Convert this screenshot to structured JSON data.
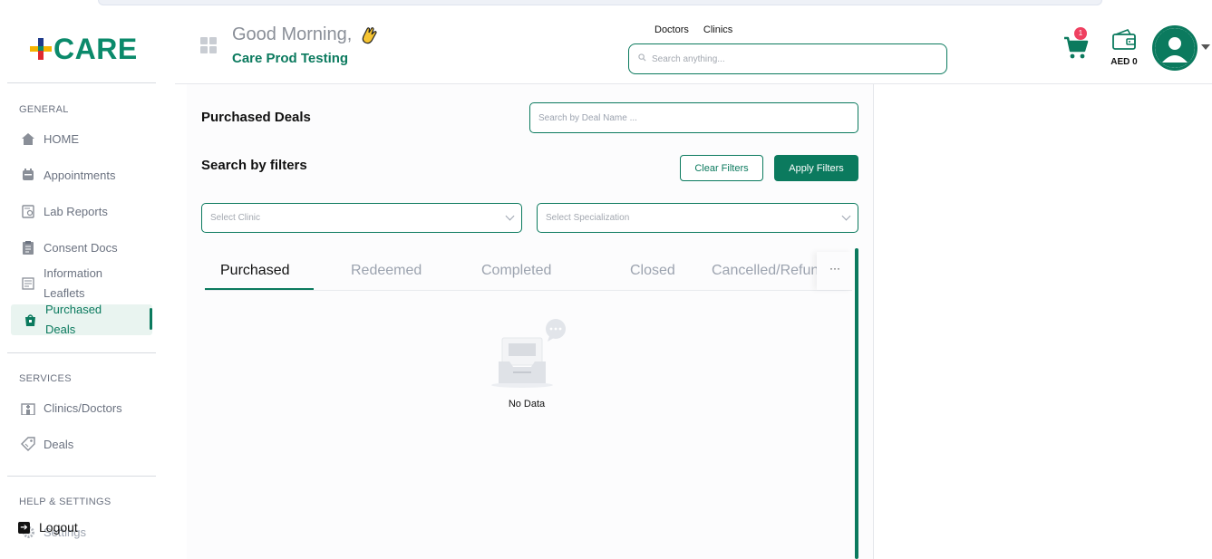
{
  "brand": {
    "name": "CARE"
  },
  "sidebar": {
    "sections": {
      "general": "GENERAL",
      "services": "SERVICES",
      "help": "HELP & SETTINGS"
    },
    "items": {
      "home": "HOME",
      "appointments": "Appointments",
      "lab_reports": "Lab Reports",
      "consent_docs": "Consent Docs",
      "info_leaflets_1": "Information",
      "info_leaflets_2": "Leaflets",
      "purchased_deals_1": "Purchased",
      "purchased_deals_2": "Deals",
      "clinics_doctors": "Clinics/Doctors",
      "deals": "Deals",
      "settings": "Settings",
      "logout": "Logout"
    }
  },
  "header": {
    "greeting": "Good Morning,",
    "user_name": "Care Prod Testing",
    "links": [
      "Doctors",
      "Clinics"
    ],
    "search_placeholder": "Search anything...",
    "cart_count": "1",
    "wallet_amount": "AED 0"
  },
  "main": {
    "title": "Purchased Deals",
    "deal_search_placeholder": "Search by Deal Name ...",
    "filters_title": "Search by filters",
    "clear_filters": "Clear Filters",
    "apply_filters": "Apply Filters",
    "select_clinic": "Select Clinic",
    "select_specialization": "Select Specialization",
    "tabs": [
      "Purchased",
      "Redeemed",
      "Completed",
      "Closed",
      "Cancelled/Refunded"
    ],
    "more": "···",
    "empty_text": "No Data"
  },
  "colors": {
    "brand": "#0b7a5e",
    "badge": "#ef4060"
  }
}
